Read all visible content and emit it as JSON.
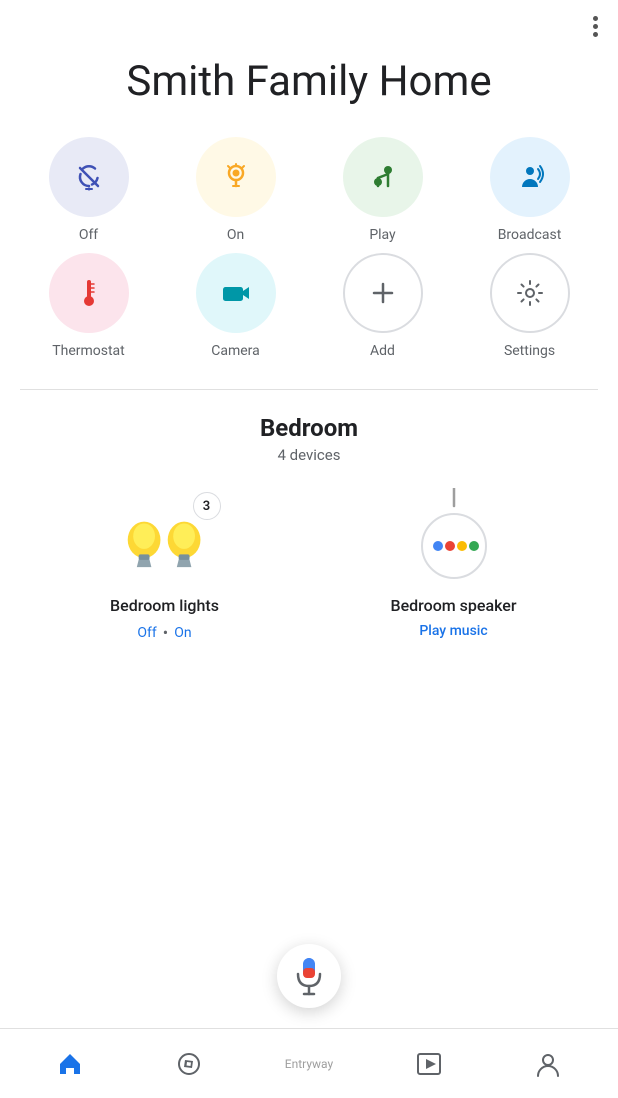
{
  "header": {
    "title": "Smith Family Home",
    "more_icon_label": "more options"
  },
  "quick_actions": [
    {
      "id": "off",
      "label": "Off",
      "circle_class": "circle-off",
      "icon_type": "off"
    },
    {
      "id": "on",
      "label": "On",
      "circle_class": "circle-on",
      "icon_type": "on"
    },
    {
      "id": "play",
      "label": "Play",
      "circle_class": "circle-play",
      "icon_type": "play"
    },
    {
      "id": "broadcast",
      "label": "Broadcast",
      "circle_class": "circle-broadcast",
      "icon_type": "broadcast"
    },
    {
      "id": "thermostat",
      "label": "Thermostat",
      "circle_class": "circle-thermostat",
      "icon_type": "thermostat"
    },
    {
      "id": "camera",
      "label": "Camera",
      "circle_class": "circle-camera",
      "icon_type": "camera"
    },
    {
      "id": "add",
      "label": "Add",
      "circle_class": "circle-add",
      "icon_type": "add"
    },
    {
      "id": "settings",
      "label": "Settings",
      "circle_class": "circle-settings",
      "icon_type": "settings"
    }
  ],
  "room": {
    "name": "Bedroom",
    "device_count": "4 devices"
  },
  "devices": [
    {
      "id": "bedroom-lights",
      "name": "Bedroom lights",
      "badge": "3",
      "status_type": "multi",
      "status_off": "Off",
      "status_separator": "•",
      "status_on": "On"
    },
    {
      "id": "bedroom-speaker",
      "name": "Bedroom speaker",
      "status_type": "action",
      "status_action": "Play music"
    }
  ],
  "bottom_nav": [
    {
      "id": "home",
      "label": "",
      "icon": "home",
      "active": true
    },
    {
      "id": "explore",
      "label": "",
      "icon": "explore",
      "active": false
    },
    {
      "id": "entryway",
      "label": "Entryway",
      "icon": "",
      "active": false,
      "is_center": true
    },
    {
      "id": "media",
      "label": "",
      "icon": "media",
      "active": false
    },
    {
      "id": "profile",
      "label": "",
      "icon": "person",
      "active": false
    }
  ],
  "voice_button_label": "Voice assistant"
}
